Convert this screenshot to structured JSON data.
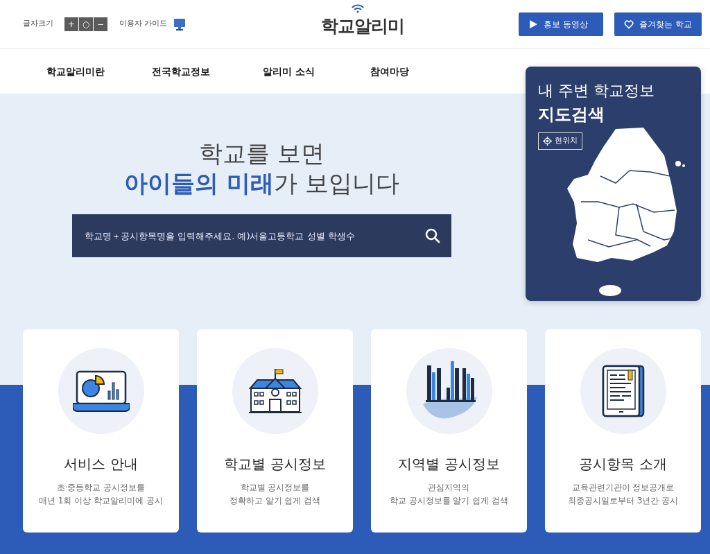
{
  "top_bar": {
    "font_size": {
      "label": "글자크기",
      "buttons": [
        "+",
        "○",
        "−"
      ]
    },
    "guide": {
      "label": "이용자 가이드"
    },
    "logo": "학교알리미",
    "buttons": [
      {
        "label": "홍보 동영상",
        "kind": "play"
      },
      {
        "label": "즐겨찾는 학교",
        "kind": "heart"
      }
    ]
  },
  "nav": {
    "items": [
      "학교알리미란",
      "전국학교정보",
      "알리미 소식",
      "참여마당"
    ]
  },
  "hero": {
    "line_1": "학교를 보면",
    "line_2": "**아이들의 미래**가 보입니다",
    "search": {
      "placeholder": "학교명＋공시항목명을 입력해주세요. 예)서울고등학교 성별 학생수"
    }
  },
  "map_panel": {
    "title": "내 주변 학교정보",
    "subtitle": "지도검색",
    "location_button": "현위치"
  },
  "cards": [
    {
      "title": "서비스 안내",
      "lines": [
        "초·중등학교 공시정보를",
        "매년 1회 이상 학교알리미에 공시"
      ]
    },
    {
      "title": "학교별 공시정보",
      "lines": [
        "학교별 공시정보를",
        "정확하고 알기 쉽게 검색"
      ]
    },
    {
      "title": "지역별 공시정보",
      "lines": [
        "관심지역의",
        "학교 공시정보를 알기 쉽게 검색"
      ]
    },
    {
      "title": "공시항목 소개",
      "lines": [
        "교육관련기관이 정보공개로",
        "최종공시일로부터 3년간 공시"
      ]
    }
  ]
}
